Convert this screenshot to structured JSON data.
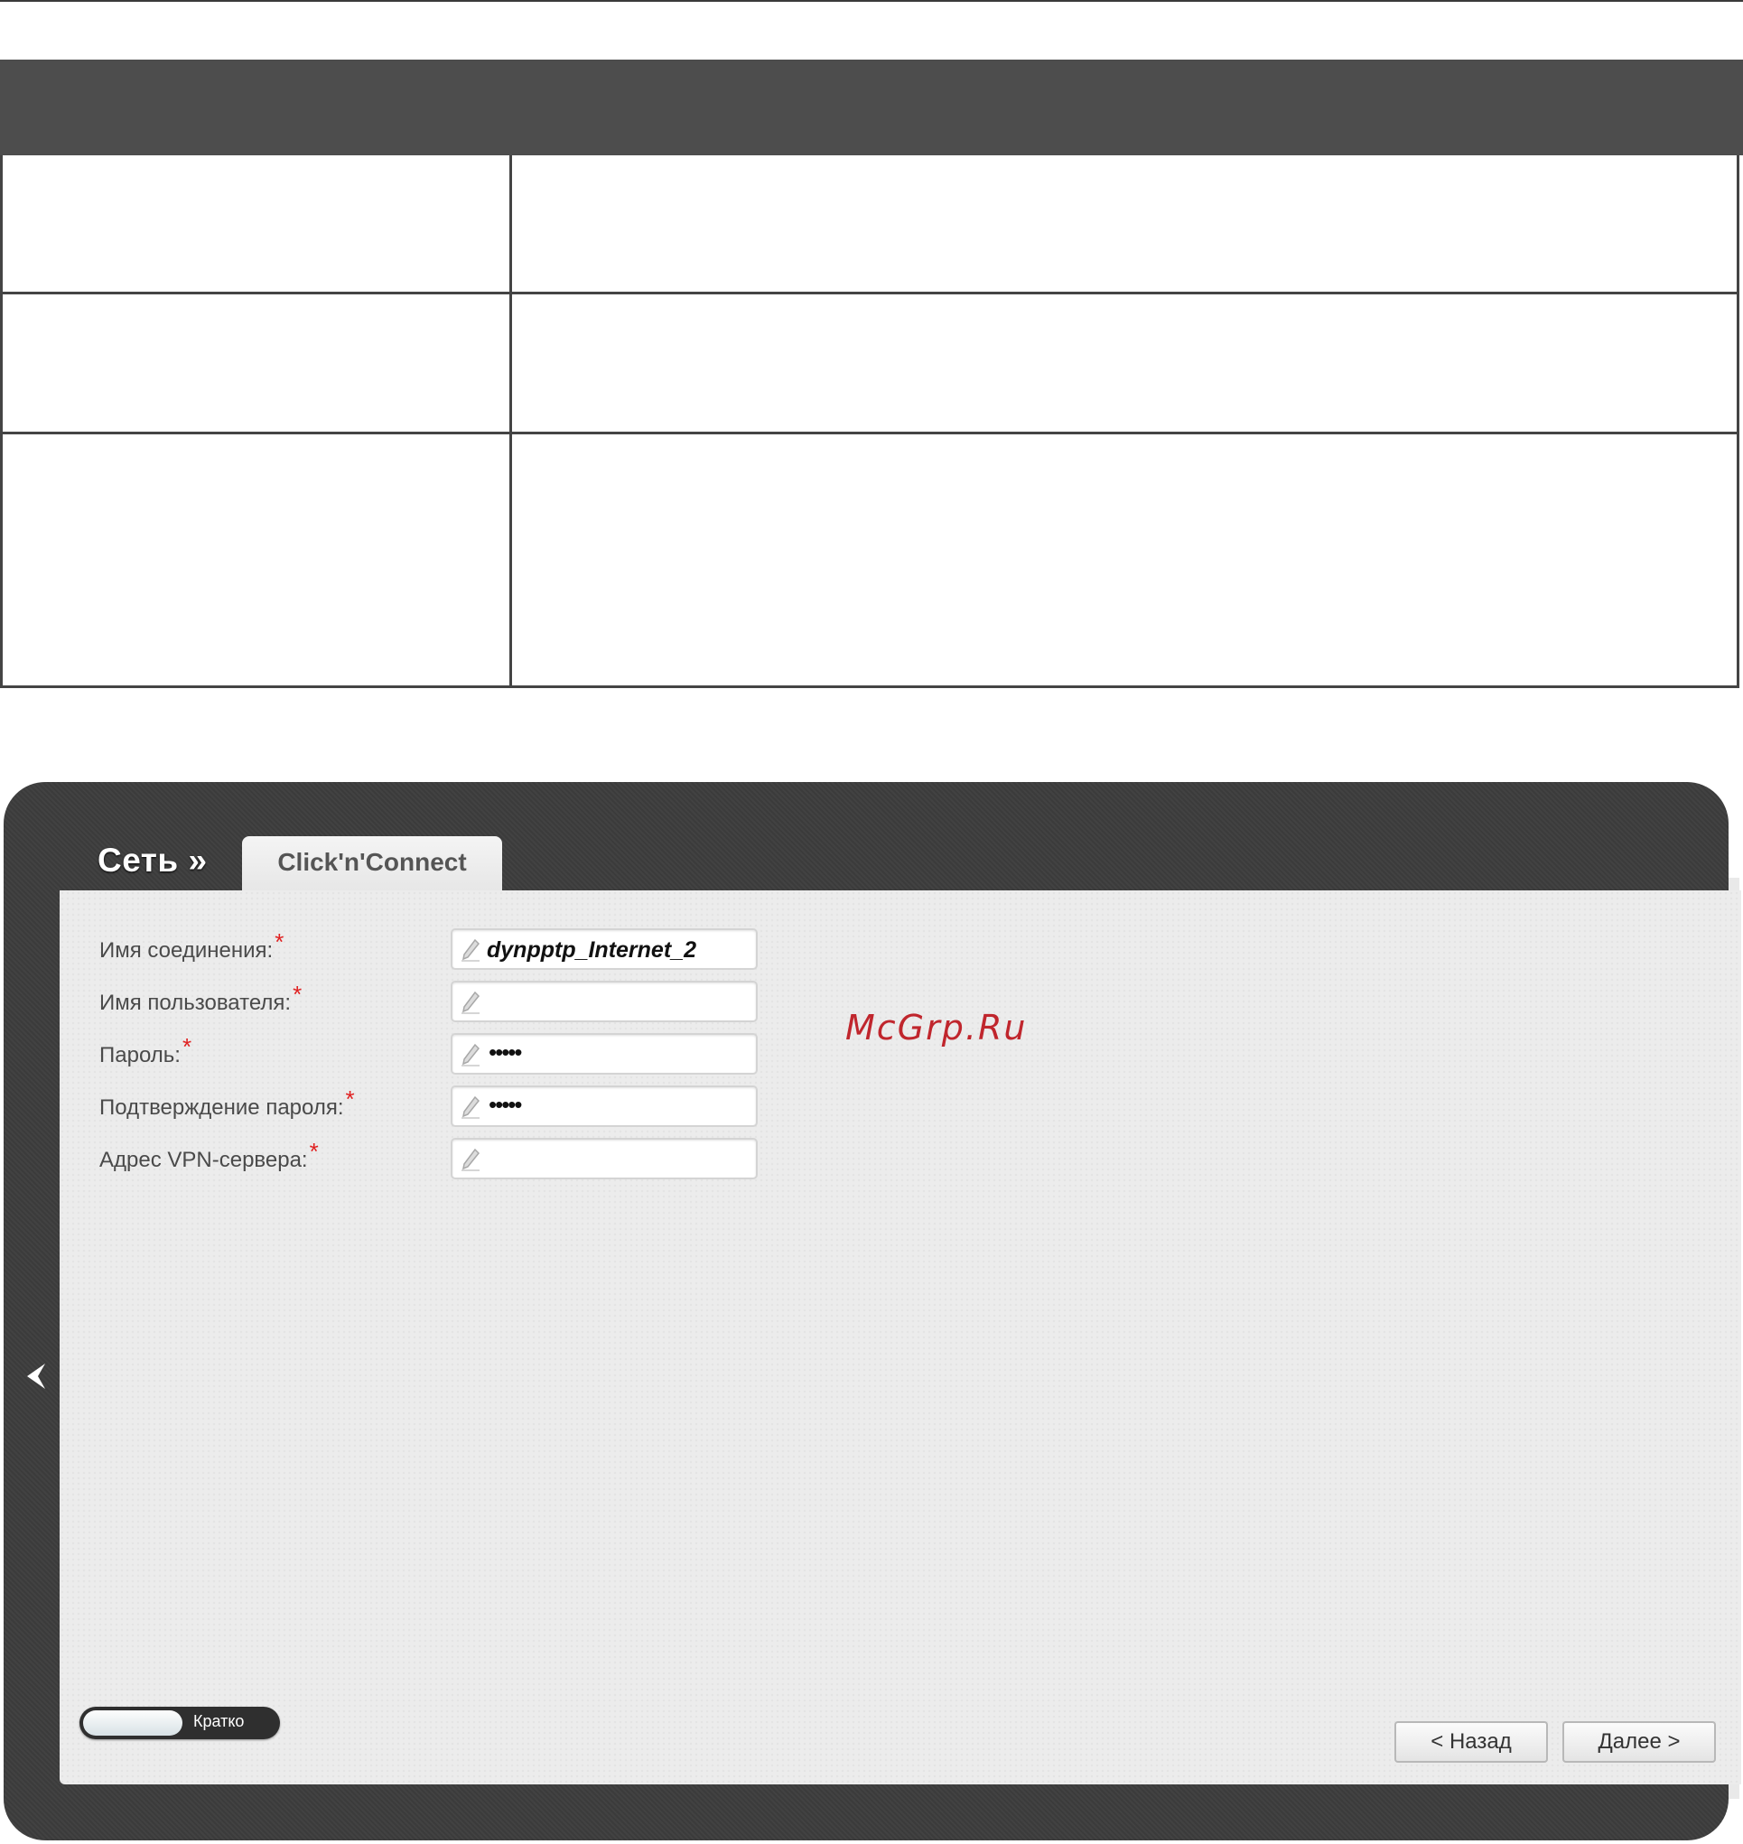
{
  "breadcrumb": {
    "section": "Сеть »",
    "tab": "Click'n'Connect"
  },
  "watermark": "McGrp.Ru",
  "form": {
    "fields": [
      {
        "label": "Имя соединения:",
        "required": "*",
        "value": "dynpptp_Internet_2",
        "type": "text"
      },
      {
        "label": "Имя пользователя:",
        "required": "*",
        "value": "",
        "type": "text"
      },
      {
        "label": "Пароль:",
        "required": "*",
        "value": "•••••",
        "type": "password"
      },
      {
        "label": "Подтверждение пароля:",
        "required": "*",
        "value": "•••••",
        "type": "password"
      },
      {
        "label": "Адрес VPN-сервера:",
        "required": "*",
        "value": "",
        "type": "text"
      }
    ]
  },
  "view_toggle": {
    "label": "Кратко"
  },
  "buttons": {
    "back": "< Назад",
    "next": "Далее >"
  },
  "icons": {
    "edit": "pencil-icon",
    "nav_back": "chevron-left-icon"
  },
  "colors": {
    "frame": "#3d3d3d",
    "panel": "#ececec",
    "required": "#e02020",
    "header": "#4d4d4d"
  }
}
